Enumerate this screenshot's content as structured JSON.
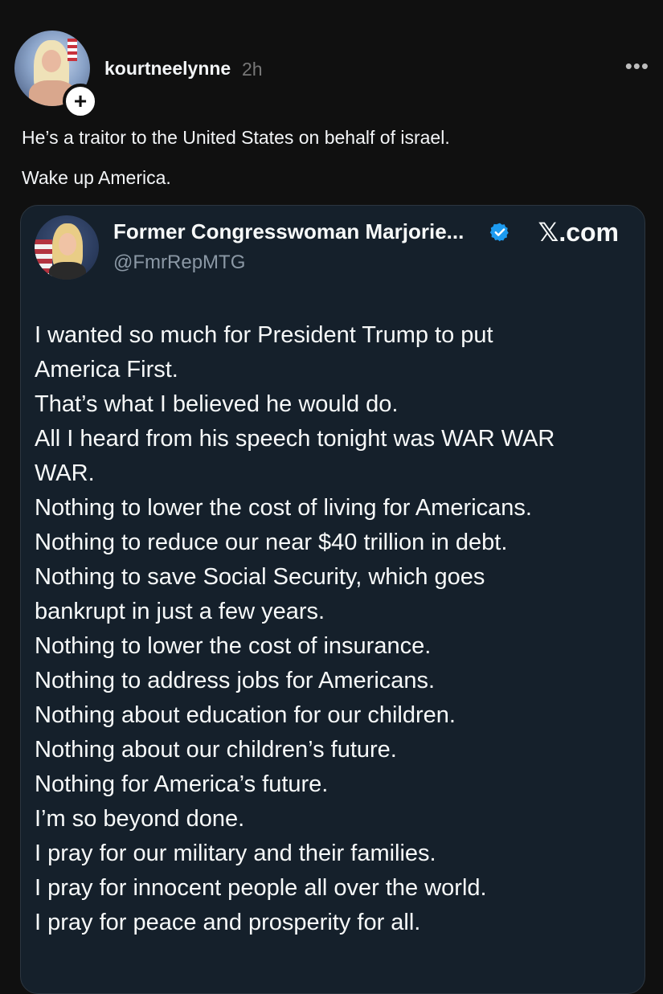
{
  "post": {
    "username": "kourtneelynne",
    "timestamp": "2h",
    "more_label": "•••",
    "follow_label": "+",
    "text_lines": [
      "He’s a traitor to the United States on behalf of  israel.",
      "Wake up America."
    ]
  },
  "quoted_tweet": {
    "display_name": "Former Congresswoman Marjorie...",
    "handle": "@FmrRepMTG",
    "source": "𝕏.com",
    "verified_color": "#1d9bf0",
    "body_lines": [
      "I wanted so much for President Trump to put",
      "America First.",
      "That’s what I believed he would do.",
      "All I heard from his speech tonight was WAR WAR",
      "WAR.",
      "Nothing to lower the cost of living for Americans.",
      "Nothing to reduce our near $40 trillion in debt.",
      "Nothing to save Social Security, which goes",
      "bankrupt in just a few years.",
      "Nothing to lower the cost of insurance.",
      "Nothing to address jobs for Americans.",
      "Nothing about education for our children.",
      "Nothing about our children’s future.",
      "Nothing for America’s future.",
      "I’m so beyond done.",
      "I pray for our military and their families.",
      "I pray for innocent people all over the world.",
      "I pray for peace and prosperity for all."
    ]
  },
  "colors": {
    "background": "#101010",
    "card_background": "#15202b",
    "muted_text": "#777777",
    "handle_text": "#8b98a5"
  }
}
